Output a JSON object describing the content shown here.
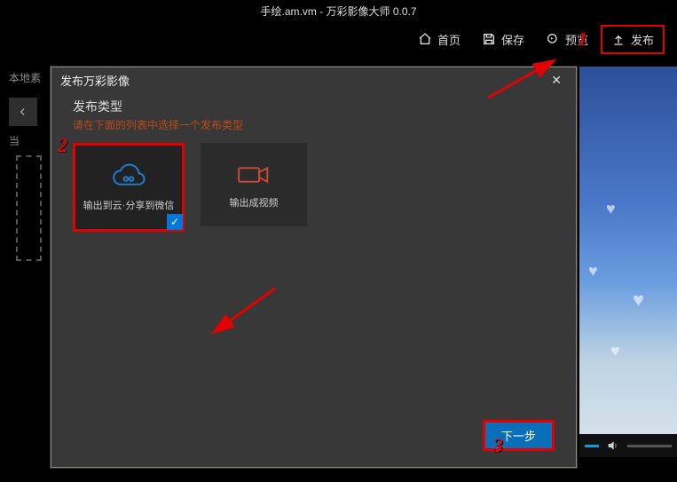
{
  "title": "手绘.am.vm - 万彩影像大师 0.0.7",
  "toolbar": {
    "home": "首页",
    "save": "保存",
    "preview": "预览",
    "publish": "发布"
  },
  "side": {
    "local": "本地素",
    "current": "当"
  },
  "dialog": {
    "title": "发布万彩影像",
    "section": "发布类型",
    "hint": "请在下面的列表中选择一个发布类型",
    "opt_cloud": "输出到云·分享到微信",
    "opt_video": "输出成视频",
    "next": "下一步"
  },
  "markers": {
    "m1": "1",
    "m2": "2",
    "m3": "3"
  }
}
